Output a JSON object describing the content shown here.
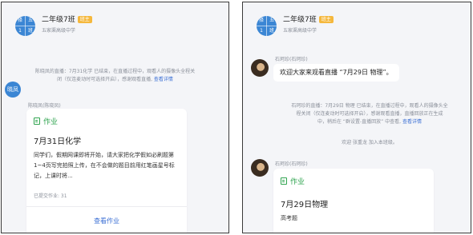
{
  "left_panel": {
    "header": {
      "avatar_chars": [
        "择",
        "五",
        "1",
        "班"
      ],
      "title": "二年级7班",
      "badge": "班主",
      "subtitle": "五家渠高级中学"
    },
    "system_notice": {
      "line1": "陈晓凤的直播：7月31化学 已结束，在直播过程中，观看人的摄像头全程关",
      "line2_text": "闭（仅连麦动时可选择开启），感谢观看直播,",
      "line2_link": "查看详情"
    },
    "message": {
      "avatar_text": "晓凤",
      "sender": "陈晓凤(陈晓凤)",
      "card": {
        "type_label": "作业",
        "title": "7月31日化学",
        "body": "同学们，假期网课即将开始，请大家把化学假如必刷题第1~4页写完拍照上传，在不会做的题目前用红笔画星号标记，上课时将...",
        "submitted": "已提交作业: 31",
        "action": "查看作业"
      }
    }
  },
  "right_panel": {
    "header": {
      "avatar_chars": [
        "择",
        "五",
        "1",
        "班"
      ],
      "title": "二年级7班",
      "badge": "班主",
      "subtitle": "五家渠高级中学"
    },
    "message1": {
      "sender": "石珂珍(石珂珍)",
      "text": "欢迎大家来观看直播 “7月29日 物理”。"
    },
    "system_notice": {
      "line1": "石珂珍的直播：7月29日 物理 已结束，在直播过程中，观看人的摄像头全",
      "line2": "程关闭（仅连麦动时可选择开启），感谢观看直播，直播回放正在生成",
      "line3_text": "中，稍后在 “群设置-直播回放” 中查看,",
      "line3_link": "查看详情"
    },
    "join_notice": "欢迎 张重龙 加入本班级。",
    "message2": {
      "sender": "石珂珍(石珂珍)",
      "card": {
        "type_label": "作业",
        "title": "7月29日物理",
        "body": "高考题"
      }
    }
  },
  "colors": {
    "accent_blue": "#3b86d4",
    "link_blue": "#3b6fd4",
    "homework_green": "#2fa44f",
    "badge_orange": "#f5b83d",
    "chat_background": "#f4f5f8"
  },
  "icons": {
    "group_avatar": "group-avatar-icon",
    "homework": "homework-icon"
  }
}
